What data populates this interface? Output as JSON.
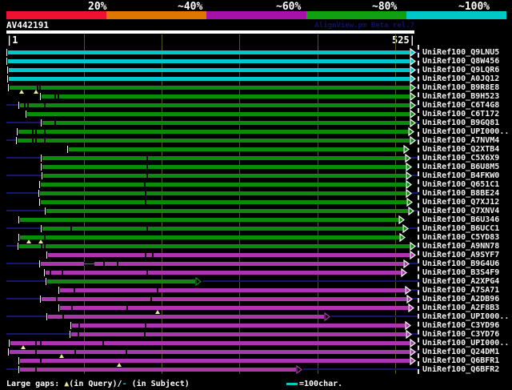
{
  "header": {
    "title": "AV442191",
    "watermark": "AlignView.pm Beta rel.7"
  },
  "ruler": {
    "start_label": "|1",
    "end_label": "525|"
  },
  "scale": {
    "segments": [
      {
        "label": "20%",
        "color": "#ef1230"
      },
      {
        "label": "~40%",
        "color": "#dd7700"
      },
      {
        "label": "~60%",
        "color": "#a412aa"
      },
      {
        "label": "~80%",
        "color": "#11a011"
      },
      {
        "label": "~100%",
        "color": "#00c8c8"
      }
    ]
  },
  "legend": {
    "gaps_prefix": "Large gaps: ",
    "query_marker": "▲",
    "query_text": "(in Query)/",
    "subject_marker": "-",
    "subject_text": " (in Subject)",
    "scale_text": "=100char."
  },
  "chart_data": {
    "type": "alignment",
    "query_id": "AV442191",
    "query_length": 525,
    "axis": {
      "min": 1,
      "max": 525,
      "grid_interval": 100,
      "grid_positions": [
        100,
        200,
        300,
        400,
        500
      ]
    },
    "colors": {
      "cyan": "#00c8c8",
      "green": "#0a8c0a",
      "magenta": "#ad35ad",
      "navy": "#16166a",
      "grid": "#54541e",
      "gap_triangle": "#efe896"
    },
    "rows": [
      {
        "label": "UniRef100_Q9LNU5",
        "color": "cyan",
        "bar": [
          2,
          519
        ],
        "leader": null,
        "tail": [
          526,
          530
        ],
        "trail": null,
        "gaps": [],
        "thin": [],
        "tris": [],
        "arrow": "solid"
      },
      {
        "label": "UniRef100_Q8W456",
        "color": "cyan",
        "bar": [
          2,
          519
        ],
        "leader": null,
        "tail": null,
        "trail": null,
        "gaps": [],
        "thin": [],
        "tris": [],
        "arrow": "solid"
      },
      {
        "label": "UniRef100_Q9LQR6",
        "color": "cyan",
        "bar": [
          3,
          519
        ],
        "leader": null,
        "tail": [
          526,
          530
        ],
        "trail": null,
        "gaps": [],
        "thin": [],
        "tris": [],
        "arrow": "solid"
      },
      {
        "label": "UniRef100_A0JQ12",
        "color": "cyan",
        "bar": [
          3,
          519
        ],
        "leader": null,
        "tail": null,
        "trail": null,
        "gaps": [],
        "thin": [],
        "tris": [],
        "arrow": "solid"
      },
      {
        "label": "UniRef100_B9R8E8",
        "color": "green",
        "bar": [
          4,
          519
        ],
        "leader": null,
        "tail": [
          526,
          530
        ],
        "trail": null,
        "gaps": [
          39,
          42
        ],
        "thin": [],
        "tris": [
          20,
          38
        ],
        "arrow": "solid"
      },
      {
        "label": "UniRef100_B9H523",
        "color": "green",
        "bar": [
          45,
          519
        ],
        "leader": null,
        "tail": null,
        "trail": null,
        "gaps": [
          62,
          66
        ],
        "thin": [],
        "tris": [],
        "arrow": "solid"
      },
      {
        "label": "UniRef100_C6T4G8",
        "color": "green",
        "bar": [
          17,
          519
        ],
        "leader": [
          0,
          15
        ],
        "tail": [
          526,
          530
        ],
        "trail": null,
        "gaps": [
          23,
          27,
          48
        ],
        "thin": [],
        "tris": [],
        "arrow": "solid"
      },
      {
        "label": "UniRef100_C6T172",
        "color": "green",
        "bar": [
          27,
          519
        ],
        "leader": null,
        "tail": null,
        "trail": null,
        "gaps": [],
        "thin": [],
        "tris": [],
        "arrow": "solid"
      },
      {
        "label": "UniRef100_B9GQ81",
        "color": "green",
        "bar": [
          46,
          519
        ],
        "leader": [
          0,
          44
        ],
        "tail": [
          526,
          530
        ],
        "trail": null,
        "gaps": [
          62
        ],
        "thin": [],
        "tris": [],
        "arrow": "solid"
      },
      {
        "label": "UniRef100_UPI000..",
        "color": "green",
        "bar": [
          15,
          517
        ],
        "leader": null,
        "tail": null,
        "trail": null,
        "gaps": [
          33,
          37,
          48
        ],
        "thin": [],
        "tris": [],
        "arrow": "solid"
      },
      {
        "label": "UniRef100_A7NVM4",
        "color": "green",
        "bar": [
          14,
          519
        ],
        "leader": [
          0,
          12
        ],
        "tail": [
          526,
          530
        ],
        "trail": null,
        "gaps": [
          33,
          37,
          48
        ],
        "thin": [],
        "tris": [],
        "arrow": "solid"
      },
      {
        "label": "UniRef100_Q2XTB4",
        "color": "green",
        "bar": [
          80,
          511
        ],
        "leader": null,
        "tail": null,
        "trail": null,
        "gaps": [],
        "thin": [],
        "tris": [],
        "arrow": "solid"
      },
      {
        "label": "UniRef100_C5X6X9",
        "color": "green",
        "bar": [
          46,
          513
        ],
        "leader": [
          0,
          44
        ],
        "tail": [
          520,
          530
        ],
        "trail": null,
        "gaps": [
          180
        ],
        "thin": [],
        "tris": [],
        "arrow": "solid"
      },
      {
        "label": "UniRef100_B6U8M5",
        "color": "green",
        "bar": [
          46,
          514
        ],
        "leader": null,
        "tail": null,
        "trail": null,
        "gaps": [
          180
        ],
        "thin": [],
        "tris": [],
        "arrow": "solid"
      },
      {
        "label": "UniRef100_B4FKW0",
        "color": "green",
        "bar": [
          47,
          514
        ],
        "leader": [
          0,
          45
        ],
        "tail": [
          521,
          530
        ],
        "trail": null,
        "gaps": [
          180
        ],
        "thin": [],
        "tris": [],
        "arrow": "solid"
      },
      {
        "label": "UniRef100_Q651C1",
        "color": "green",
        "bar": [
          44,
          514
        ],
        "leader": null,
        "tail": null,
        "trail": null,
        "gaps": [
          177
        ],
        "thin": [],
        "tris": [],
        "arrow": "solid"
      },
      {
        "label": "UniRef100_B8BE24",
        "color": "green",
        "bar": [
          43,
          514
        ],
        "leader": [
          0,
          41
        ],
        "tail": [
          521,
          530
        ],
        "trail": null,
        "gaps": [
          178
        ],
        "thin": [],
        "tris": [],
        "arrow": "solid"
      },
      {
        "label": "UniRef100_Q7XJ12",
        "color": "green",
        "bar": [
          44,
          515
        ],
        "leader": null,
        "tail": null,
        "trail": null,
        "gaps": [
          178
        ],
        "thin": [],
        "tris": [],
        "arrow": "solid"
      },
      {
        "label": "UniRef100_Q7XNV4",
        "color": "green",
        "bar": [
          51,
          517
        ],
        "leader": [
          0,
          49
        ],
        "tail": [
          524,
          530
        ],
        "trail": null,
        "gaps": [],
        "thin": [],
        "tris": [],
        "arrow": "solid"
      },
      {
        "label": "UniRef100_B6U346",
        "color": "green",
        "bar": [
          17,
          504
        ],
        "leader": null,
        "tail": null,
        "trail": null,
        "gaps": [],
        "thin": [],
        "tris": [],
        "arrow": "solid"
      },
      {
        "label": "UniRef100_B6UCC1",
        "color": "green",
        "bar": [
          46,
          510
        ],
        "leader": [
          0,
          44
        ],
        "tail": [
          517,
          530
        ],
        "trail": null,
        "gaps": [
          82,
          180
        ],
        "thin": [],
        "tris": [],
        "arrow": "solid"
      },
      {
        "label": "UniRef100_C5YD83",
        "color": "green",
        "bar": [
          17,
          505
        ],
        "leader": null,
        "tail": null,
        "trail": null,
        "gaps": [
          48
        ],
        "thin": [],
        "tris": [
          29,
          44
        ],
        "arrow": "solid"
      },
      {
        "label": "UniRef100_A9NN78",
        "color": "green",
        "bar": [
          16,
          519
        ],
        "leader": [
          0,
          14
        ],
        "tail": [
          526,
          530
        ],
        "trail": null,
        "gaps": [
          44,
          48
        ],
        "thin": [],
        "tris": [],
        "arrow": "solid"
      },
      {
        "label": "UniRef100_A9SYF7",
        "color": "magenta",
        "bar": [
          54,
          519
        ],
        "leader": null,
        "tail": null,
        "trail": null,
        "gaps": [
          178,
          187
        ],
        "thin": [],
        "tris": [],
        "arrow": "solid"
      },
      {
        "label": "UniRef100_B9G4U6",
        "color": "magenta",
        "bar": [
          44,
          511
        ],
        "leader": [
          0,
          42
        ],
        "tail": [
          518,
          530
        ],
        "trail": null,
        "gaps": [
          125,
          142
        ],
        "thin": [
          [
            100,
            113
          ]
        ],
        "tris": [],
        "arrow": "solid"
      },
      {
        "label": "UniRef100_B3S4F9",
        "color": "magenta",
        "bar": [
          50,
          507
        ],
        "leader": null,
        "tail": null,
        "trail": null,
        "gaps": [
          56,
          71,
          180
        ],
        "thin": [],
        "tris": [],
        "arrow": "solid"
      },
      {
        "label": "UniRef100_A2XPG4",
        "color": "green",
        "bar": [
          53,
          243
        ],
        "leader": [
          0,
          50
        ],
        "tail": null,
        "trail": [
          252,
          530
        ],
        "gaps": [],
        "thin": [],
        "tris": [],
        "arrow": "hollow"
      },
      {
        "label": "UniRef100_A7SA71",
        "color": "magenta",
        "bar": [
          69,
          513
        ],
        "leader": null,
        "tail": [
          520,
          530
        ],
        "trail": null,
        "gaps": [
          86,
          194
        ],
        "thin": [],
        "tris": [],
        "arrow": "solid"
      },
      {
        "label": "UniRef100_A2DB96",
        "color": "magenta",
        "bar": [
          45,
          515
        ],
        "leader": [
          0,
          43
        ],
        "tail": [
          522,
          530
        ],
        "trail": null,
        "gaps": [
          64,
          185
        ],
        "thin": [],
        "tris": [],
        "arrow": "solid"
      },
      {
        "label": "UniRef100_A2F8B3",
        "color": "magenta",
        "bar": [
          69,
          517
        ],
        "leader": null,
        "tail": null,
        "trail": null,
        "gaps": [
          83,
          154
        ],
        "thin": [],
        "tris": [
          195
        ],
        "arrow": "solid"
      },
      {
        "label": "UniRef100_UPI000..",
        "color": "magenta",
        "bar": [
          54,
          409
        ],
        "leader": [
          0,
          51
        ],
        "tail": null,
        "trail": [
          418,
          530
        ],
        "gaps": [
          72
        ],
        "thin": [],
        "tris": [],
        "arrow": "hollow"
      },
      {
        "label": "UniRef100_C3YD96",
        "color": "magenta",
        "bar": [
          84,
          513
        ],
        "leader": null,
        "tail": null,
        "trail": null,
        "gaps": [
          93,
          178
        ],
        "thin": [],
        "tris": [],
        "arrow": "solid"
      },
      {
        "label": "UniRef100_C3YD76",
        "color": "magenta",
        "bar": [
          83,
          514
        ],
        "leader": [
          0,
          81
        ],
        "tail": [
          521,
          530
        ],
        "trail": null,
        "gaps": [
          92,
          177
        ],
        "thin": [],
        "tris": [],
        "arrow": "solid"
      },
      {
        "label": "UniRef100_UPI000..",
        "color": "magenta",
        "bar": [
          5,
          519
        ],
        "leader": null,
        "tail": null,
        "trail": null,
        "gaps": [
          37,
          43,
          124
        ],
        "thin": [],
        "tris": [
          22
        ],
        "arrow": "solid"
      },
      {
        "label": "UniRef100_Q24DM1",
        "color": "magenta",
        "bar": [
          4,
          519
        ],
        "leader": null,
        "tail": [
          526,
          530
        ],
        "trail": null,
        "gaps": [
          37,
          88,
          153
        ],
        "thin": [],
        "tris": [
          71
        ],
        "arrow": "solid"
      },
      {
        "label": "UniRef100_Q6BFR1",
        "color": "magenta",
        "bar": [
          17,
          519
        ],
        "leader": null,
        "tail": null,
        "trail": null,
        "gaps": [
          43
        ],
        "thin": [],
        "tris": [
          145
        ],
        "arrow": "solid"
      },
      {
        "label": "UniRef100_Q6BFR2",
        "color": "magenta",
        "bar": [
          17,
          373
        ],
        "leader": [
          0,
          15
        ],
        "tail": null,
        "trail": [
          382,
          530
        ],
        "gaps": [
          37
        ],
        "thin": [],
        "tris": [],
        "arrow": "hollow"
      }
    ]
  }
}
